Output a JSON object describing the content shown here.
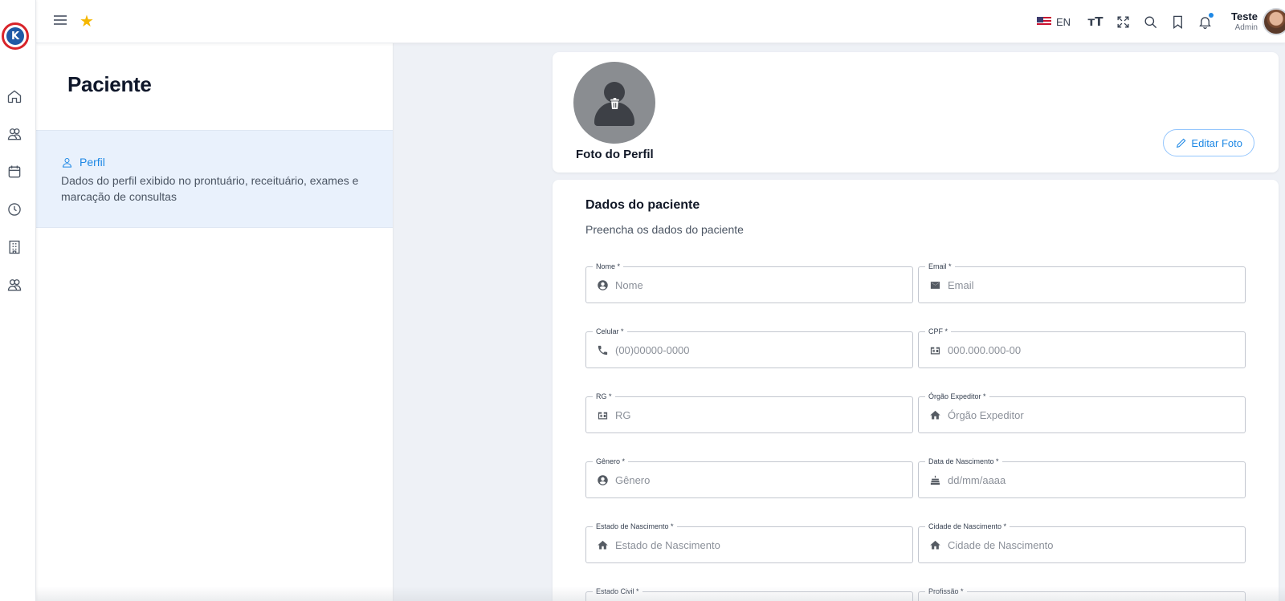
{
  "topbar": {
    "language": "EN",
    "font_size_label": "TT",
    "user": {
      "name": "Teste",
      "role": "Admin"
    },
    "notification_dot_color": "#1e88e5"
  },
  "sidebar": {
    "page_title": "Paciente",
    "nav_items": [
      {
        "label": "Perfil",
        "icon": "user-icon",
        "description": "Dados do perfil exibido no prontuário, receituário, exames e marcação de consultas",
        "active": true
      }
    ]
  },
  "rail": {
    "icons": [
      "home-icon",
      "users-icon",
      "calendar-icon",
      "clock-icon",
      "building-icon",
      "users-icon"
    ]
  },
  "profile_card": {
    "label": "Foto do Perfil",
    "edit_button": "Editar Foto"
  },
  "form": {
    "title": "Dados do paciente",
    "subtitle": "Preencha os dados do paciente",
    "fields": [
      {
        "label": "Nome *",
        "placeholder": "Nome",
        "icon": "account-circle-icon"
      },
      {
        "label": "Email *",
        "placeholder": "Email",
        "icon": "mail-icon"
      },
      {
        "label": "Celular *",
        "placeholder": "(00)00000-0000",
        "icon": "phone-icon"
      },
      {
        "label": "CPF *",
        "placeholder": "000.000.000-00",
        "icon": "id-card-icon"
      },
      {
        "label": "RG *",
        "placeholder": "RG",
        "icon": "id-card-icon"
      },
      {
        "label": "Órgão Expeditor *",
        "placeholder": "Órgão Expeditor",
        "icon": "home-filled-icon"
      },
      {
        "label": "Gênero *",
        "placeholder": "Gênero",
        "icon": "account-circle-icon"
      },
      {
        "label": "Data de Nascimento *",
        "placeholder": "dd/mm/aaaa",
        "icon": "cake-icon"
      },
      {
        "label": "Estado de Nascimento *",
        "placeholder": "Estado de Nascimento",
        "icon": "home-filled-icon"
      },
      {
        "label": "Cidade de Nascimento *",
        "placeholder": "Cidade de Nascimento",
        "icon": "home-filled-icon"
      },
      {
        "label": "Estado Civil *",
        "placeholder": "",
        "icon": ""
      },
      {
        "label": "Profissão *",
        "placeholder": "",
        "icon": ""
      }
    ]
  },
  "colors": {
    "accent": "#1e88e5",
    "nav_active_bg": "#e9f1fc",
    "logo_red": "#d8242a",
    "star": "#f5b700"
  }
}
